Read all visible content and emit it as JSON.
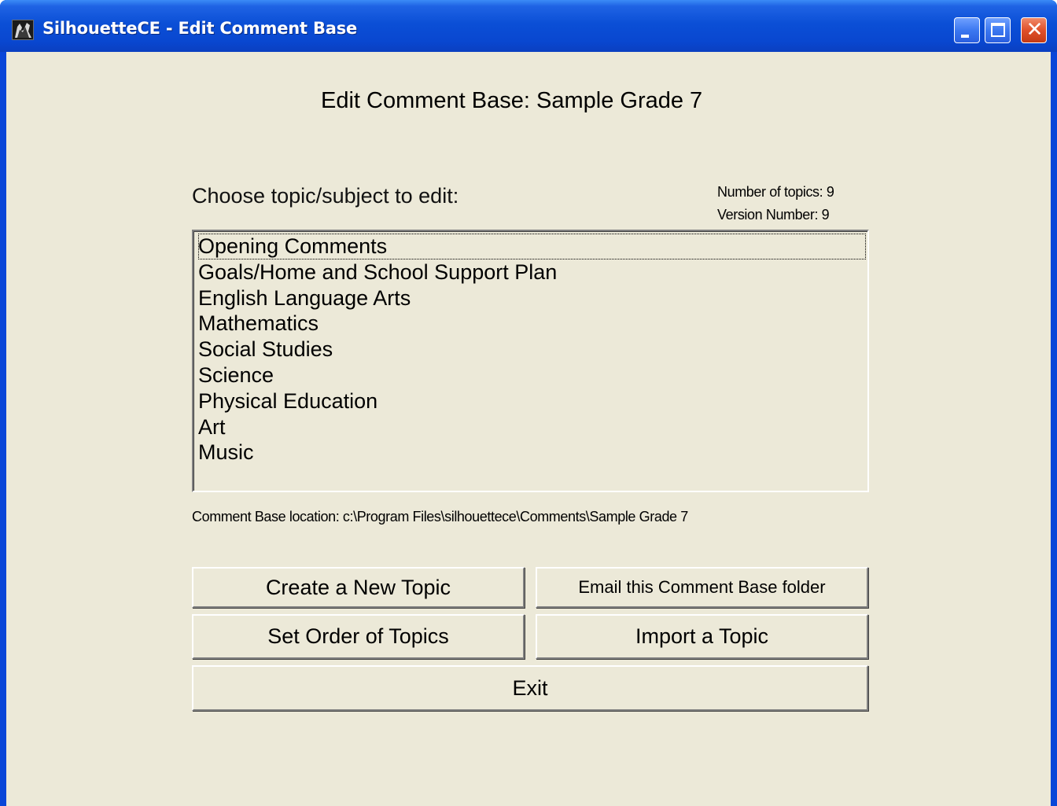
{
  "window": {
    "title": "SilhouetteCE - Edit Comment Base",
    "icon": "silhouette-app-icon",
    "controls": [
      "minimize-icon",
      "maximize-icon",
      "close-icon"
    ]
  },
  "heading": "Edit Comment Base: Sample Grade 7",
  "choose_label": "Choose topic/subject to edit:",
  "meta": {
    "topics": "Number of topics: 9",
    "version": "Version Number: 9"
  },
  "topics": [
    "Opening Comments",
    "Goals/Home and School Support Plan",
    "English Language Arts",
    "Mathematics",
    "Social Studies",
    "Science",
    "Physical Education",
    "Art",
    "Music"
  ],
  "focused_topic_index": 0,
  "location": "Comment Base location: c:\\Program Files\\silhouettece\\Comments\\Sample Grade 7",
  "buttons": {
    "create": "Create a New Topic",
    "email": "Email this Comment Base folder",
    "order": "Set Order of Topics",
    "import": "Import a Topic",
    "exit": "Exit"
  },
  "colors": {
    "titlebar": "#0a46d8",
    "client_bg": "#ece9d8",
    "close_button": "#e0502a"
  }
}
